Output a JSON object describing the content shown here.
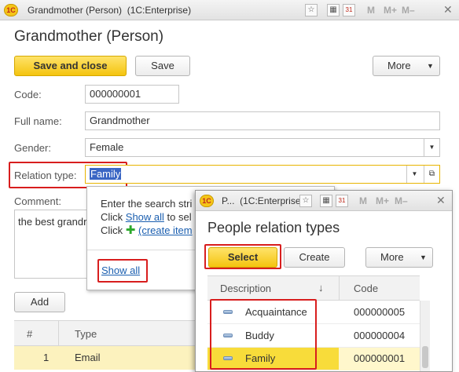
{
  "window": {
    "title": "Grandmother (Person)",
    "app": "(1C:Enterprise)",
    "logo": "1C",
    "toolbar": {
      "m": "M",
      "m_plus": "M+",
      "m_minus": "M–",
      "close": "✕",
      "calendar": "31"
    }
  },
  "form": {
    "title": "Grandmother (Person)",
    "buttons": {
      "save_close": "Save and close",
      "save": "Save",
      "more": "More"
    },
    "fields": {
      "code_label": "Code:",
      "code_value": "000000001",
      "fullname_label": "Full name:",
      "fullname_value": "Grandmother",
      "gender_label": "Gender:",
      "gender_value": "Female",
      "relation_label": "Relation type:",
      "relation_value": "Family",
      "comment_label": "Comment:",
      "comment_value": "the best grandr"
    },
    "autocomplete": {
      "line1": "Enter the search stri",
      "line2_prefix": "Click ",
      "line2_link": "Show all",
      "line2_suffix": " to sel",
      "line3_prefix": "Click ",
      "line3_link": "(create item",
      "show_all": "Show all"
    },
    "add_button": "Add",
    "table": {
      "headers": [
        "#",
        "Type"
      ],
      "rows": [
        {
          "num": "1",
          "type": "Email"
        }
      ]
    }
  },
  "popup": {
    "title_short": "P...",
    "app": "(1C:Enterprise)",
    "heading": "People relation types",
    "buttons": {
      "select": "Select",
      "create": "Create",
      "more": "More"
    },
    "columns": {
      "description": "Description",
      "sort_arrow": "↓",
      "code": "Code"
    },
    "rows": [
      {
        "description": "Acquaintance",
        "code": "000000005"
      },
      {
        "description": "Buddy",
        "code": "000000004"
      },
      {
        "description": "Family",
        "code": "000000001"
      }
    ],
    "selected_row": "Family",
    "colors": {
      "selected_row": "#f8dc3a",
      "primary_button": "#f4c40f",
      "highlight_border": "#d81e1e"
    }
  }
}
